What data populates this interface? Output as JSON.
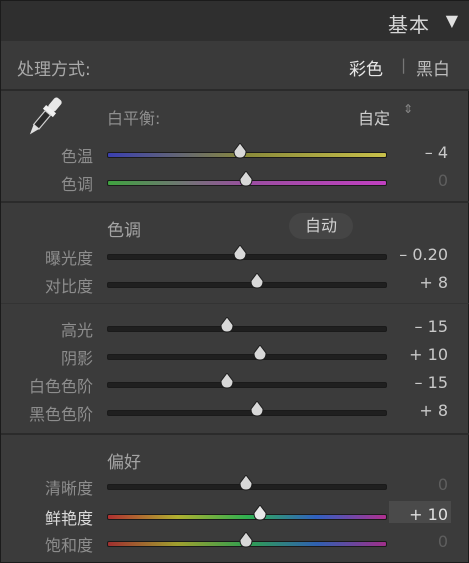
{
  "header": {
    "title": "基本",
    "toggle": "▼"
  },
  "treatment": {
    "label": "处理方式:",
    "color": "彩色",
    "separator": "|",
    "bw": "黑白"
  },
  "white_balance": {
    "label": "白平衡:",
    "value": "自定",
    "arrows": "⇕"
  },
  "tone_group": {
    "title": "色调",
    "auto": "自动"
  },
  "presence_group": {
    "title": "偏好"
  },
  "sliders": {
    "temp": {
      "label": "色温",
      "value": "– 4",
      "level": 0.48
    },
    "tint": {
      "label": "色调",
      "value": "0",
      "level": 0.5
    },
    "exposure": {
      "label": "曝光度",
      "value": "– 0.20",
      "level": 0.48
    },
    "contrast": {
      "label": "对比度",
      "value": "+ 8",
      "level": 0.54
    },
    "highlights": {
      "label": "高光",
      "value": "– 15",
      "level": 0.43
    },
    "shadows": {
      "label": "阴影",
      "value": "+ 10",
      "level": 0.55
    },
    "whites": {
      "label": "白色色阶",
      "value": "– 15",
      "level": 0.43
    },
    "blacks": {
      "label": "黑色色阶",
      "value": "+ 8",
      "level": 0.54
    },
    "clarity": {
      "label": "清晰度",
      "value": "0",
      "level": 0.5
    },
    "vibrance": {
      "label": "鲜艳度",
      "value": "+ 10",
      "level": 0.55
    },
    "saturation": {
      "label": "饱和度",
      "value": "0",
      "level": 0.5
    }
  },
  "colors": {
    "temp_gradient": [
      "#3a3fb0",
      "#8a8a3a",
      "#c8c04a"
    ],
    "tint_gradient": [
      "#3fa23f",
      "#9a4ea0",
      "#c040c0"
    ],
    "vibrance_gradient": [
      "#b03030",
      "#b0b030",
      "#30b050",
      "#3060c0",
      "#b03090"
    ],
    "saturation_gradient": [
      "#a02f2f",
      "#a0a02f",
      "#2fa050",
      "#2f60b0",
      "#a02f8a"
    ]
  }
}
